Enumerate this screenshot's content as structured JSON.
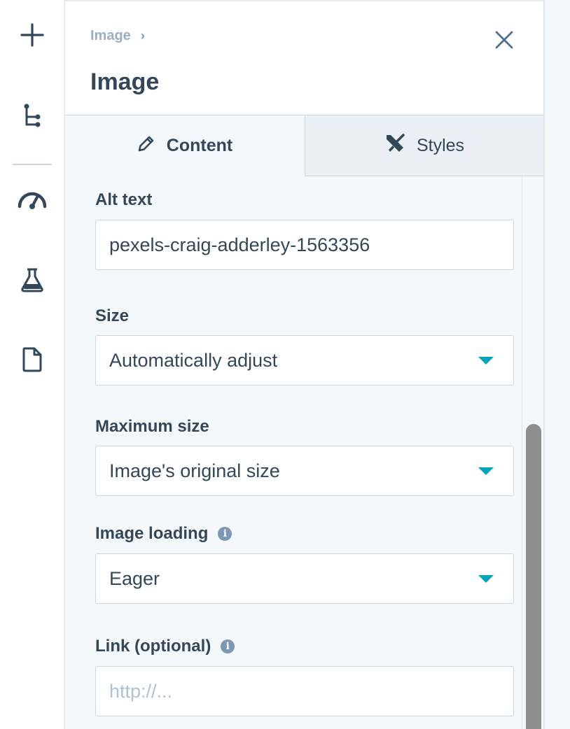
{
  "rail": {
    "items": [
      {
        "name": "add-icon"
      },
      {
        "name": "tree-icon"
      },
      {
        "name": "speedometer-icon"
      },
      {
        "name": "flask-icon"
      },
      {
        "name": "document-icon"
      }
    ]
  },
  "header": {
    "breadcrumb": "Image",
    "breadcrumb_separator": "›",
    "title": "Image",
    "close_icon": "close-icon"
  },
  "tabs": [
    {
      "label": "Content",
      "icon": "pencil-icon",
      "active": true
    },
    {
      "label": "Styles",
      "icon": "brush-icon",
      "active": false
    }
  ],
  "form": {
    "alt_text": {
      "label": "Alt text",
      "value": "pexels-craig-adderley-1563356"
    },
    "size": {
      "label": "Size",
      "value": "Automatically adjust"
    },
    "max_size": {
      "label": "Maximum size",
      "value": "Image's original size"
    },
    "loading": {
      "label": "Image loading",
      "value": "Eager",
      "info_glyph": "i"
    },
    "link": {
      "label": "Link (optional)",
      "placeholder": "http://...",
      "info_glyph": "i"
    }
  },
  "colors": {
    "accent_caret": "#00a4bd",
    "text": "#33475b",
    "muted": "#99afc4",
    "panel_bg": "#f5f8fa"
  }
}
